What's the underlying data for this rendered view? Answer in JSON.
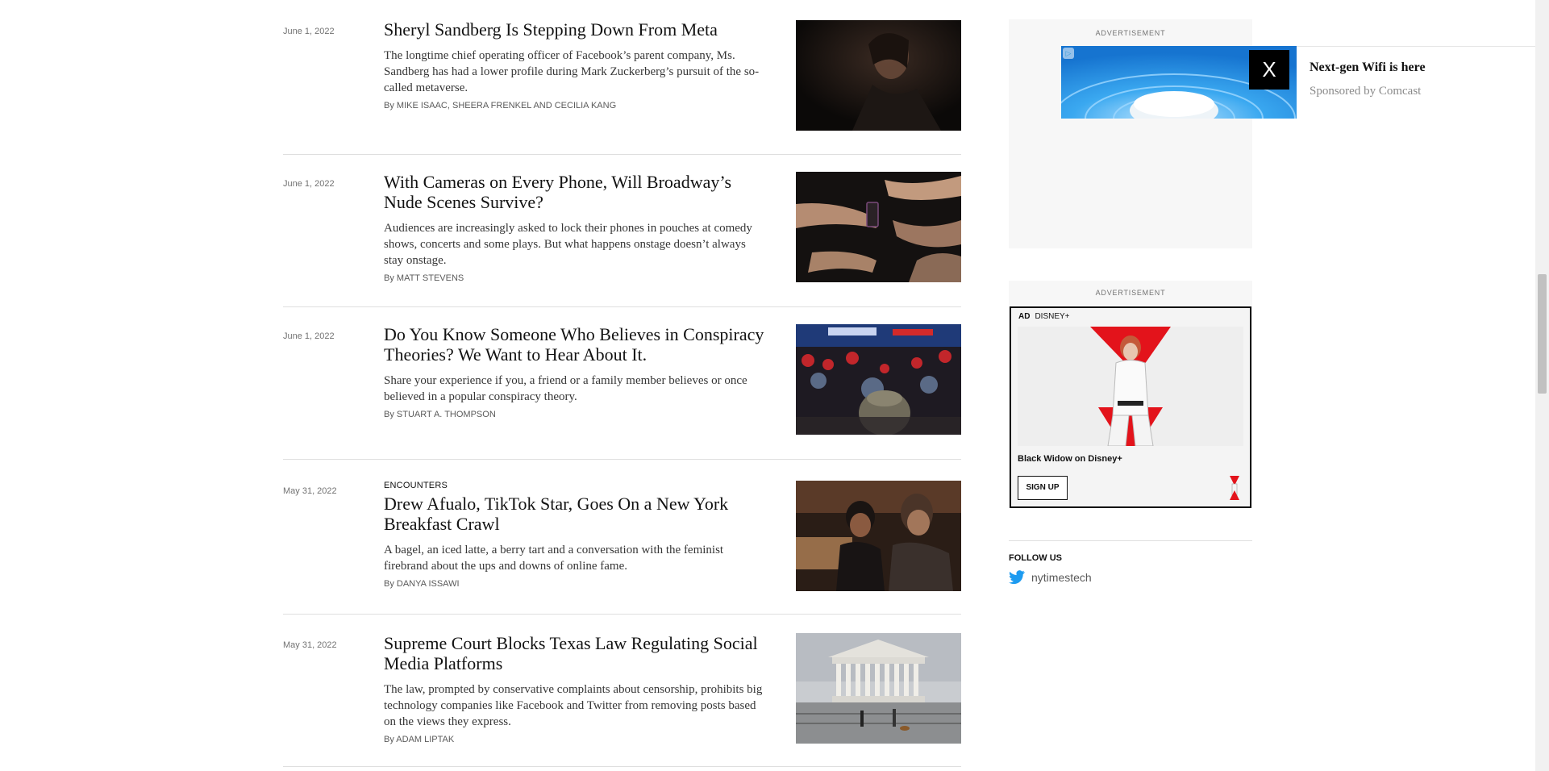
{
  "articles": [
    {
      "date": "June 1, 2022",
      "kicker": "",
      "headline": "Sheryl Sandberg Is Stepping Down From Meta",
      "summary": "The longtime chief operating officer of Facebook’s parent company, Ms. Sandberg has had a lower profile during Mark Zuckerberg’s pursuit of the so-called metaverse.",
      "by": "By",
      "authors": "MIKE ISAAC, SHEERA FRENKEL and CECILIA KANG"
    },
    {
      "date": "June 1, 2022",
      "kicker": "",
      "headline": "With Cameras on Every Phone, Will Broadway’s Nude Scenes Survive?",
      "summary": "Audiences are increasingly asked to lock their phones in pouches at comedy shows, concerts and some plays. But what happens onstage doesn’t always stay onstage.",
      "by": "By",
      "authors": "MATT STEVENS"
    },
    {
      "date": "June 1, 2022",
      "kicker": "",
      "headline": "Do You Know Someone Who Believes in Conspiracy Theories? We Want to Hear About It.",
      "summary": "Share your experience if you, a friend or a family member believes or once believed in a popular conspiracy theory.",
      "by": "By",
      "authors": "STUART A. THOMPSON"
    },
    {
      "date": "May 31, 2022",
      "kicker": "ENCOUNTERS",
      "headline": "Drew Afualo, TikTok Star, Goes On a New York Breakfast Crawl",
      "summary": "A bagel, an iced latte, a berry tart and a conversation with the feminist firebrand about the ups and downs of online fame.",
      "by": "By",
      "authors": "DANYA ISSAWI"
    },
    {
      "date": "May 31, 2022",
      "kicker": "",
      "headline": "Supreme Court Blocks Texas Law Regulating Social Media Platforms",
      "summary": "The law, prompted by conservative complaints about censorship, prohibits big technology companies like Facebook and Twitter from removing posts based on the views they express.",
      "by": "By",
      "authors": "ADAM LIPTAK"
    }
  ],
  "sidebar": {
    "ad1_label": "ADVERTISEMENT",
    "ad2_label": "ADVERTISEMENT",
    "follow_label": "FOLLOW US",
    "follow_handle": "nytimestech"
  },
  "wifi_ad": {
    "close_label": "X",
    "title": "Next-gen Wifi is here",
    "sponsor": "Sponsored by Comcast"
  },
  "disney_ad": {
    "ad_tag": "AD",
    "brand": "DISNEY+",
    "title": "Black Widow on Disney+",
    "cta": "SIGN UP"
  },
  "colors": {
    "twitter_blue": "#1d9bf0",
    "widow_red": "#e3131b",
    "wifi_blue": "#1f8fe0"
  }
}
